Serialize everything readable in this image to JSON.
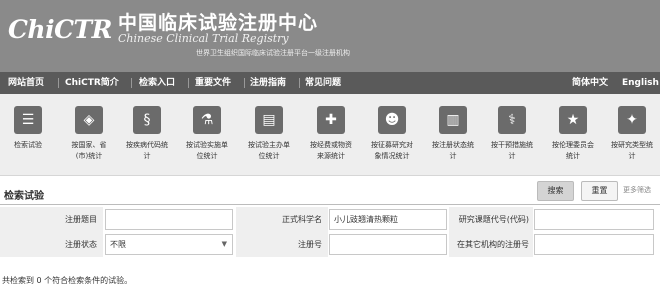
{
  "header": {
    "logo": "ChiCTR",
    "title_cn": "中国临床试验注册中心",
    "title_en": "Chinese Clinical Trial Registry",
    "subtitle": "世界卫生组织国际临床试验注册平台一级注册机构"
  },
  "nav": {
    "items": [
      "网站首页",
      "ChiCTR简介",
      "检索入口",
      "重要文件",
      "注册指南",
      "常见问题"
    ],
    "lang_cn": "简体中文",
    "lang_en": "English"
  },
  "stats": {
    "items": [
      {
        "label": "检索试验",
        "icon": "list-icon"
      },
      {
        "label": "按国家、省\n(市)统计",
        "icon": "map-icon"
      },
      {
        "label": "按疾病代码统\n计",
        "icon": "dna-icon"
      },
      {
        "label": "按试验实施单\n位统计",
        "icon": "flask-icon"
      },
      {
        "label": "按试验主办单\n位统计",
        "icon": "clipboard-icon"
      },
      {
        "label": "按经费或物资\n来源统计",
        "icon": "medkit-icon"
      },
      {
        "label": "按征募研究对\n象情况统计",
        "icon": "group-icon"
      },
      {
        "label": "按注册状态统\n计",
        "icon": "battery-icon"
      },
      {
        "label": "按干预措施统\n计",
        "icon": "doctor-icon"
      },
      {
        "label": "按伦理委员会\n统计",
        "icon": "star-icon"
      },
      {
        "label": "按研究类型统\n计",
        "icon": "sparkle-icon"
      }
    ]
  },
  "search": {
    "title": "检索试验",
    "search_button": "搜索",
    "reset_button": "重置",
    "more_filter": "更多筛选",
    "fields": {
      "reg_title_label": "注册题目",
      "reg_title_value": "",
      "sci_name_label": "正式科学名",
      "sci_name_value": "小儿豉翘清热颗粒",
      "study_code_label": "研究课题代号(代码)",
      "study_code_value": "",
      "status_label": "注册状态",
      "status_value": "不限",
      "reg_no_label": "注册号",
      "reg_no_value": "",
      "other_reg_label": "在其它机构的注册号",
      "other_reg_value": ""
    },
    "result_text": "共检索到 0 个符合检索条件的试验。"
  }
}
